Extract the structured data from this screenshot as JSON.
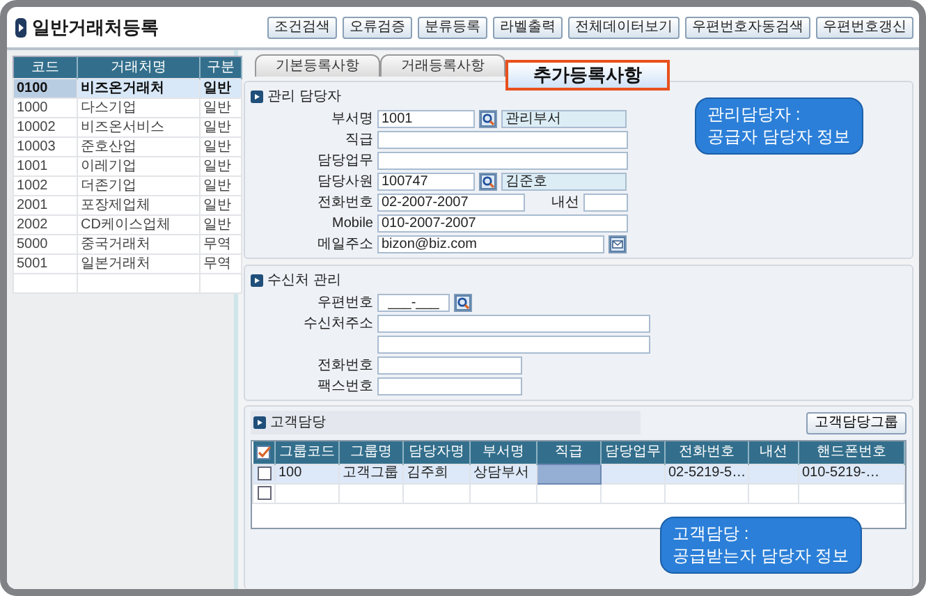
{
  "window": {
    "title": "일반거래처등록"
  },
  "toolbar": [
    "조건검색",
    "오류검증",
    "분류등록",
    "라벨출력",
    "전체데이터보기",
    "우편번호자동검색",
    "우편번호갱신"
  ],
  "vendor_list": {
    "columns": [
      "코드",
      "거래처명",
      "구분"
    ],
    "rows": [
      {
        "cells": [
          "0100",
          "비즈온거래처",
          "일반"
        ],
        "selected": true
      },
      {
        "cells": [
          "1000",
          "다스기업",
          "일반"
        ],
        "selected": false
      },
      {
        "cells": [
          "10002",
          "비즈온서비스",
          "일반"
        ],
        "selected": false
      },
      {
        "cells": [
          "10003",
          "준호산업",
          "일반"
        ],
        "selected": false
      },
      {
        "cells": [
          "1001",
          "이레기업",
          "일반"
        ],
        "selected": false
      },
      {
        "cells": [
          "1002",
          "더존기업",
          "일반"
        ],
        "selected": false
      },
      {
        "cells": [
          "2001",
          "포장제업체",
          "일반"
        ],
        "selected": false
      },
      {
        "cells": [
          "2002",
          "CD케이스업체",
          "일반"
        ],
        "selected": false
      },
      {
        "cells": [
          "5000",
          "중국거래처",
          "무역"
        ],
        "selected": false
      },
      {
        "cells": [
          "5001",
          "일본거래처",
          "무역"
        ],
        "selected": false
      }
    ]
  },
  "tabs": [
    {
      "label": "기본등록사항",
      "selected": false
    },
    {
      "label": "거래등록사항",
      "selected": false
    },
    {
      "label": "추가등록사항",
      "selected": true
    }
  ],
  "sections": [
    {
      "title": "관리 담당자",
      "fields": [
        {
          "kind": "lookup",
          "label": "부서명",
          "value": "1001",
          "display": "관리부서"
        },
        {
          "kind": "text",
          "label": "직급"
        },
        {
          "kind": "text",
          "label": "담당업무"
        },
        {
          "kind": "lookup",
          "label": "담당사원",
          "value": "100747",
          "display": "김준호"
        },
        {
          "kind": "phone",
          "label": "전화번호",
          "value": "02-2007-2007",
          "ext_label": "내선"
        },
        {
          "kind": "text",
          "label": "Mobile",
          "value": "010-2007-2007"
        },
        {
          "kind": "email",
          "label": "메일주소",
          "value": "bizon@biz.com"
        }
      ]
    },
    {
      "title": "수신처 관리",
      "fields": [
        {
          "kind": "zip",
          "label": "우편번호",
          "value": "___-___"
        },
        {
          "kind": "long",
          "label": "수신처주소"
        },
        {
          "kind": "long"
        },
        {
          "kind": "medium",
          "label": "전화번호"
        },
        {
          "kind": "medium",
          "label": "팩스번호"
        }
      ]
    }
  ],
  "contacts": {
    "title": "고객담당",
    "button": "고객담당그룹",
    "columns": [
      "그룹코드",
      "그룹명",
      "담당자명",
      "부서명",
      "직급",
      "담당업무",
      "전화번호",
      "내선",
      "핸드폰번호"
    ],
    "rows": [
      {
        "selected": true,
        "checked": false,
        "cells": [
          {
            "text": "100",
            "selected": false
          },
          {
            "text": "고객그룹",
            "selected": false
          },
          {
            "text": "김주희",
            "selected": false
          },
          {
            "text": "상담부서",
            "selected": false
          },
          {
            "selected": true
          },
          {
            "selected": false
          },
          {
            "text": "02-5219-5…",
            "selected": false
          },
          {
            "selected": false
          },
          {
            "text": "010-5219-…",
            "selected": false
          }
        ]
      },
      {
        "selected": false,
        "checked": false,
        "cells": [
          {
            "selected": false
          },
          {
            "selected": false
          },
          {
            "selected": false
          },
          {
            "selected": false
          },
          {
            "selected": false
          },
          {
            "selected": false
          },
          {
            "selected": false
          },
          {
            "selected": false
          },
          {
            "selected": false
          }
        ]
      }
    ]
  },
  "callouts": [
    {
      "text": "관리담당자 :\n공급자 담당자 정보"
    },
    {
      "text": "고객담당 :\n공급받는자 담당자 정보"
    }
  ]
}
